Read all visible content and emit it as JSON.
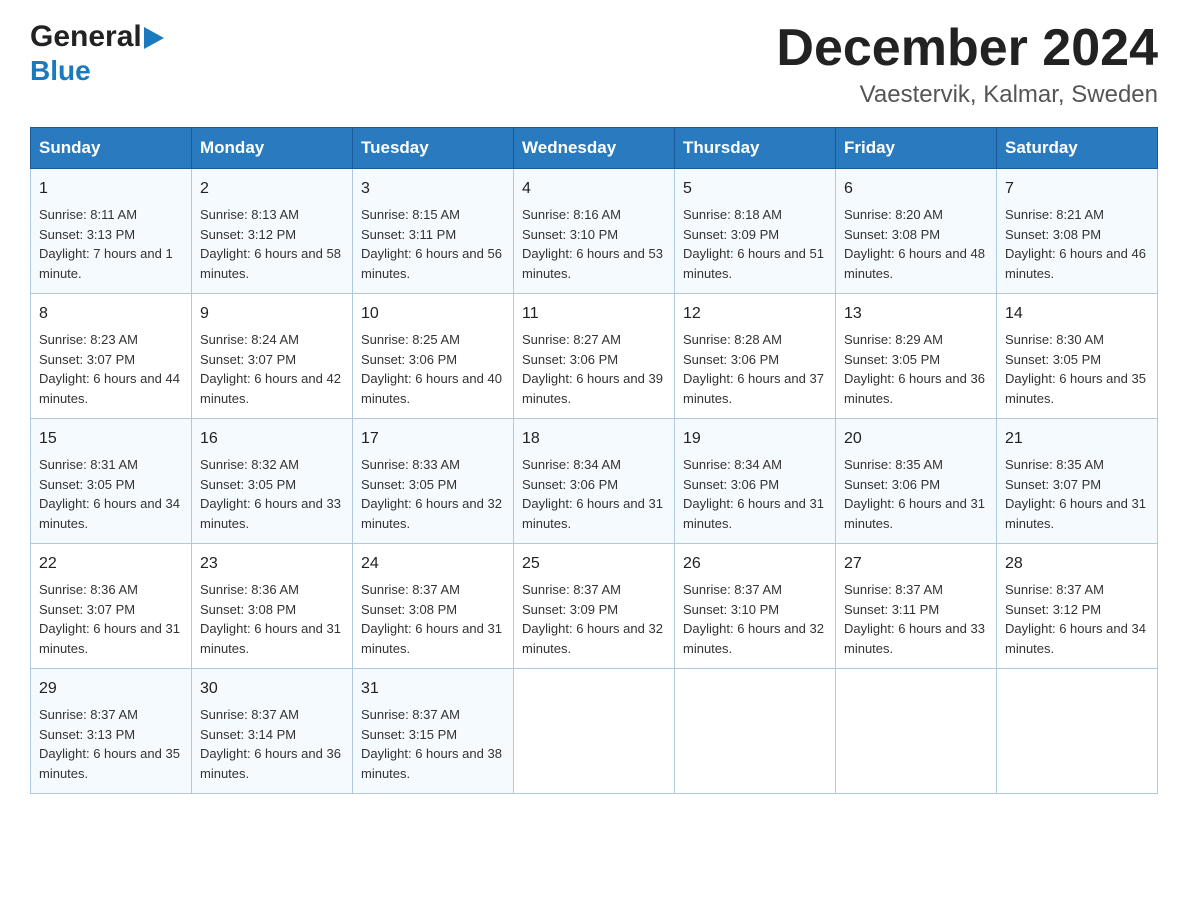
{
  "header": {
    "logo_line1": "General",
    "logo_line2": "Blue",
    "month_title": "December 2024",
    "location": "Vaestervik, Kalmar, Sweden"
  },
  "weekdays": [
    "Sunday",
    "Monday",
    "Tuesday",
    "Wednesday",
    "Thursday",
    "Friday",
    "Saturday"
  ],
  "weeks": [
    [
      {
        "day": "1",
        "sunrise": "8:11 AM",
        "sunset": "3:13 PM",
        "daylight": "7 hours and 1 minute."
      },
      {
        "day": "2",
        "sunrise": "8:13 AM",
        "sunset": "3:12 PM",
        "daylight": "6 hours and 58 minutes."
      },
      {
        "day": "3",
        "sunrise": "8:15 AM",
        "sunset": "3:11 PM",
        "daylight": "6 hours and 56 minutes."
      },
      {
        "day": "4",
        "sunrise": "8:16 AM",
        "sunset": "3:10 PM",
        "daylight": "6 hours and 53 minutes."
      },
      {
        "day": "5",
        "sunrise": "8:18 AM",
        "sunset": "3:09 PM",
        "daylight": "6 hours and 51 minutes."
      },
      {
        "day": "6",
        "sunrise": "8:20 AM",
        "sunset": "3:08 PM",
        "daylight": "6 hours and 48 minutes."
      },
      {
        "day": "7",
        "sunrise": "8:21 AM",
        "sunset": "3:08 PM",
        "daylight": "6 hours and 46 minutes."
      }
    ],
    [
      {
        "day": "8",
        "sunrise": "8:23 AM",
        "sunset": "3:07 PM",
        "daylight": "6 hours and 44 minutes."
      },
      {
        "day": "9",
        "sunrise": "8:24 AM",
        "sunset": "3:07 PM",
        "daylight": "6 hours and 42 minutes."
      },
      {
        "day": "10",
        "sunrise": "8:25 AM",
        "sunset": "3:06 PM",
        "daylight": "6 hours and 40 minutes."
      },
      {
        "day": "11",
        "sunrise": "8:27 AM",
        "sunset": "3:06 PM",
        "daylight": "6 hours and 39 minutes."
      },
      {
        "day": "12",
        "sunrise": "8:28 AM",
        "sunset": "3:06 PM",
        "daylight": "6 hours and 37 minutes."
      },
      {
        "day": "13",
        "sunrise": "8:29 AM",
        "sunset": "3:05 PM",
        "daylight": "6 hours and 36 minutes."
      },
      {
        "day": "14",
        "sunrise": "8:30 AM",
        "sunset": "3:05 PM",
        "daylight": "6 hours and 35 minutes."
      }
    ],
    [
      {
        "day": "15",
        "sunrise": "8:31 AM",
        "sunset": "3:05 PM",
        "daylight": "6 hours and 34 minutes."
      },
      {
        "day": "16",
        "sunrise": "8:32 AM",
        "sunset": "3:05 PM",
        "daylight": "6 hours and 33 minutes."
      },
      {
        "day": "17",
        "sunrise": "8:33 AM",
        "sunset": "3:05 PM",
        "daylight": "6 hours and 32 minutes."
      },
      {
        "day": "18",
        "sunrise": "8:34 AM",
        "sunset": "3:06 PM",
        "daylight": "6 hours and 31 minutes."
      },
      {
        "day": "19",
        "sunrise": "8:34 AM",
        "sunset": "3:06 PM",
        "daylight": "6 hours and 31 minutes."
      },
      {
        "day": "20",
        "sunrise": "8:35 AM",
        "sunset": "3:06 PM",
        "daylight": "6 hours and 31 minutes."
      },
      {
        "day": "21",
        "sunrise": "8:35 AM",
        "sunset": "3:07 PM",
        "daylight": "6 hours and 31 minutes."
      }
    ],
    [
      {
        "day": "22",
        "sunrise": "8:36 AM",
        "sunset": "3:07 PM",
        "daylight": "6 hours and 31 minutes."
      },
      {
        "day": "23",
        "sunrise": "8:36 AM",
        "sunset": "3:08 PM",
        "daylight": "6 hours and 31 minutes."
      },
      {
        "day": "24",
        "sunrise": "8:37 AM",
        "sunset": "3:08 PM",
        "daylight": "6 hours and 31 minutes."
      },
      {
        "day": "25",
        "sunrise": "8:37 AM",
        "sunset": "3:09 PM",
        "daylight": "6 hours and 32 minutes."
      },
      {
        "day": "26",
        "sunrise": "8:37 AM",
        "sunset": "3:10 PM",
        "daylight": "6 hours and 32 minutes."
      },
      {
        "day": "27",
        "sunrise": "8:37 AM",
        "sunset": "3:11 PM",
        "daylight": "6 hours and 33 minutes."
      },
      {
        "day": "28",
        "sunrise": "8:37 AM",
        "sunset": "3:12 PM",
        "daylight": "6 hours and 34 minutes."
      }
    ],
    [
      {
        "day": "29",
        "sunrise": "8:37 AM",
        "sunset": "3:13 PM",
        "daylight": "6 hours and 35 minutes."
      },
      {
        "day": "30",
        "sunrise": "8:37 AM",
        "sunset": "3:14 PM",
        "daylight": "6 hours and 36 minutes."
      },
      {
        "day": "31",
        "sunrise": "8:37 AM",
        "sunset": "3:15 PM",
        "daylight": "6 hours and 38 minutes."
      },
      null,
      null,
      null,
      null
    ]
  ]
}
